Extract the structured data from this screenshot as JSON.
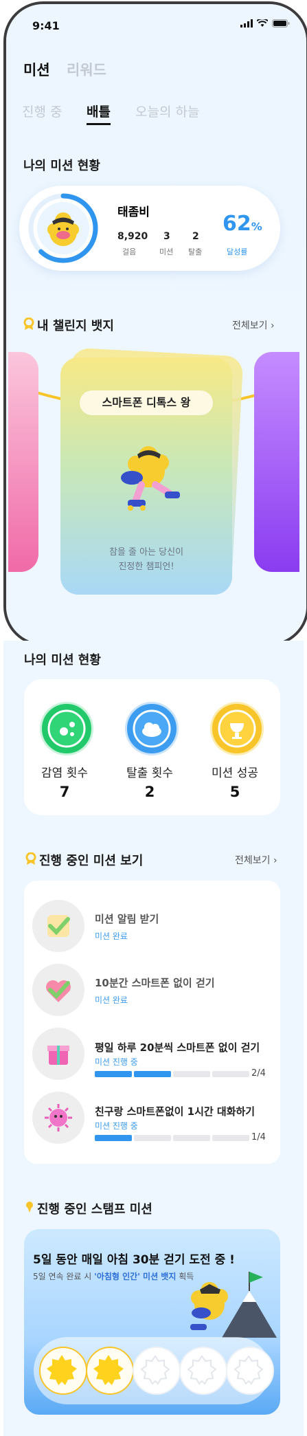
{
  "status_bar": {
    "time": "9:41"
  },
  "top_tabs": {
    "mission": "미션",
    "reward": "리워드"
  },
  "sub_tabs": {
    "in_progress": "진행 중",
    "battle": "배틀",
    "today_sky": "오늘의 하늘"
  },
  "my_status": {
    "title": "나의 미션 현황",
    "name": "태좀비",
    "steps_value": "8,920",
    "steps_label": "걸음",
    "missions_value": "3",
    "missions_label": "미션",
    "escape_value": "2",
    "escape_label": "탈출",
    "percent_value": "62",
    "percent_unit": "%",
    "percent_label": "달성률",
    "progress_fraction": 0.62
  },
  "badges": {
    "title": "내 챌린지 뱃지",
    "see_all": "전체보기",
    "card_title": "스마트폰 디톡스 왕",
    "card_line1": "참을 줄 아는 당신이",
    "card_line2": "진정한 챔피언!"
  },
  "summary": {
    "title": "나의 미션 현황",
    "items": [
      {
        "label": "감염 횟수",
        "value": "7",
        "color": "#22c96b"
      },
      {
        "label": "탈출 횟수",
        "value": "2",
        "color": "#3b9cf0"
      },
      {
        "label": "미션 성공",
        "value": "5",
        "color": "#f7c52a"
      }
    ]
  },
  "missions": {
    "title": "진행 중인 미션 보기",
    "see_all": "전체보기",
    "items": [
      {
        "title": "미션 알림 받기",
        "status": "미션 완료"
      },
      {
        "title": "10분간 스마트폰 없이 걷기",
        "status": "미션 완료"
      },
      {
        "title": "평일 하루 20분씩 스마트폰 없이 걷기",
        "status": "미션 진행 중",
        "count": "2/4",
        "progress": 0.5
      },
      {
        "title": "친구랑 스마트폰없이 1시간 대화하기",
        "status": "미션 진행 중",
        "count": "1/4",
        "progress": 0.25
      }
    ]
  },
  "stamp": {
    "title": "진행 중인 스탬프 미션",
    "headline": "5일 동안 매일 아침 30분 걷기  도전 중 !",
    "sub_prefix": "5일 연속 완료 시 ",
    "sub_highlight": "'아침형 인간' 미션 뱃지",
    "sub_suffix": " 획득",
    "completed_days": 2,
    "total_days": 5
  },
  "colors": {
    "accent": "#2f95ee",
    "badge_yellow": "#f7c52a"
  }
}
